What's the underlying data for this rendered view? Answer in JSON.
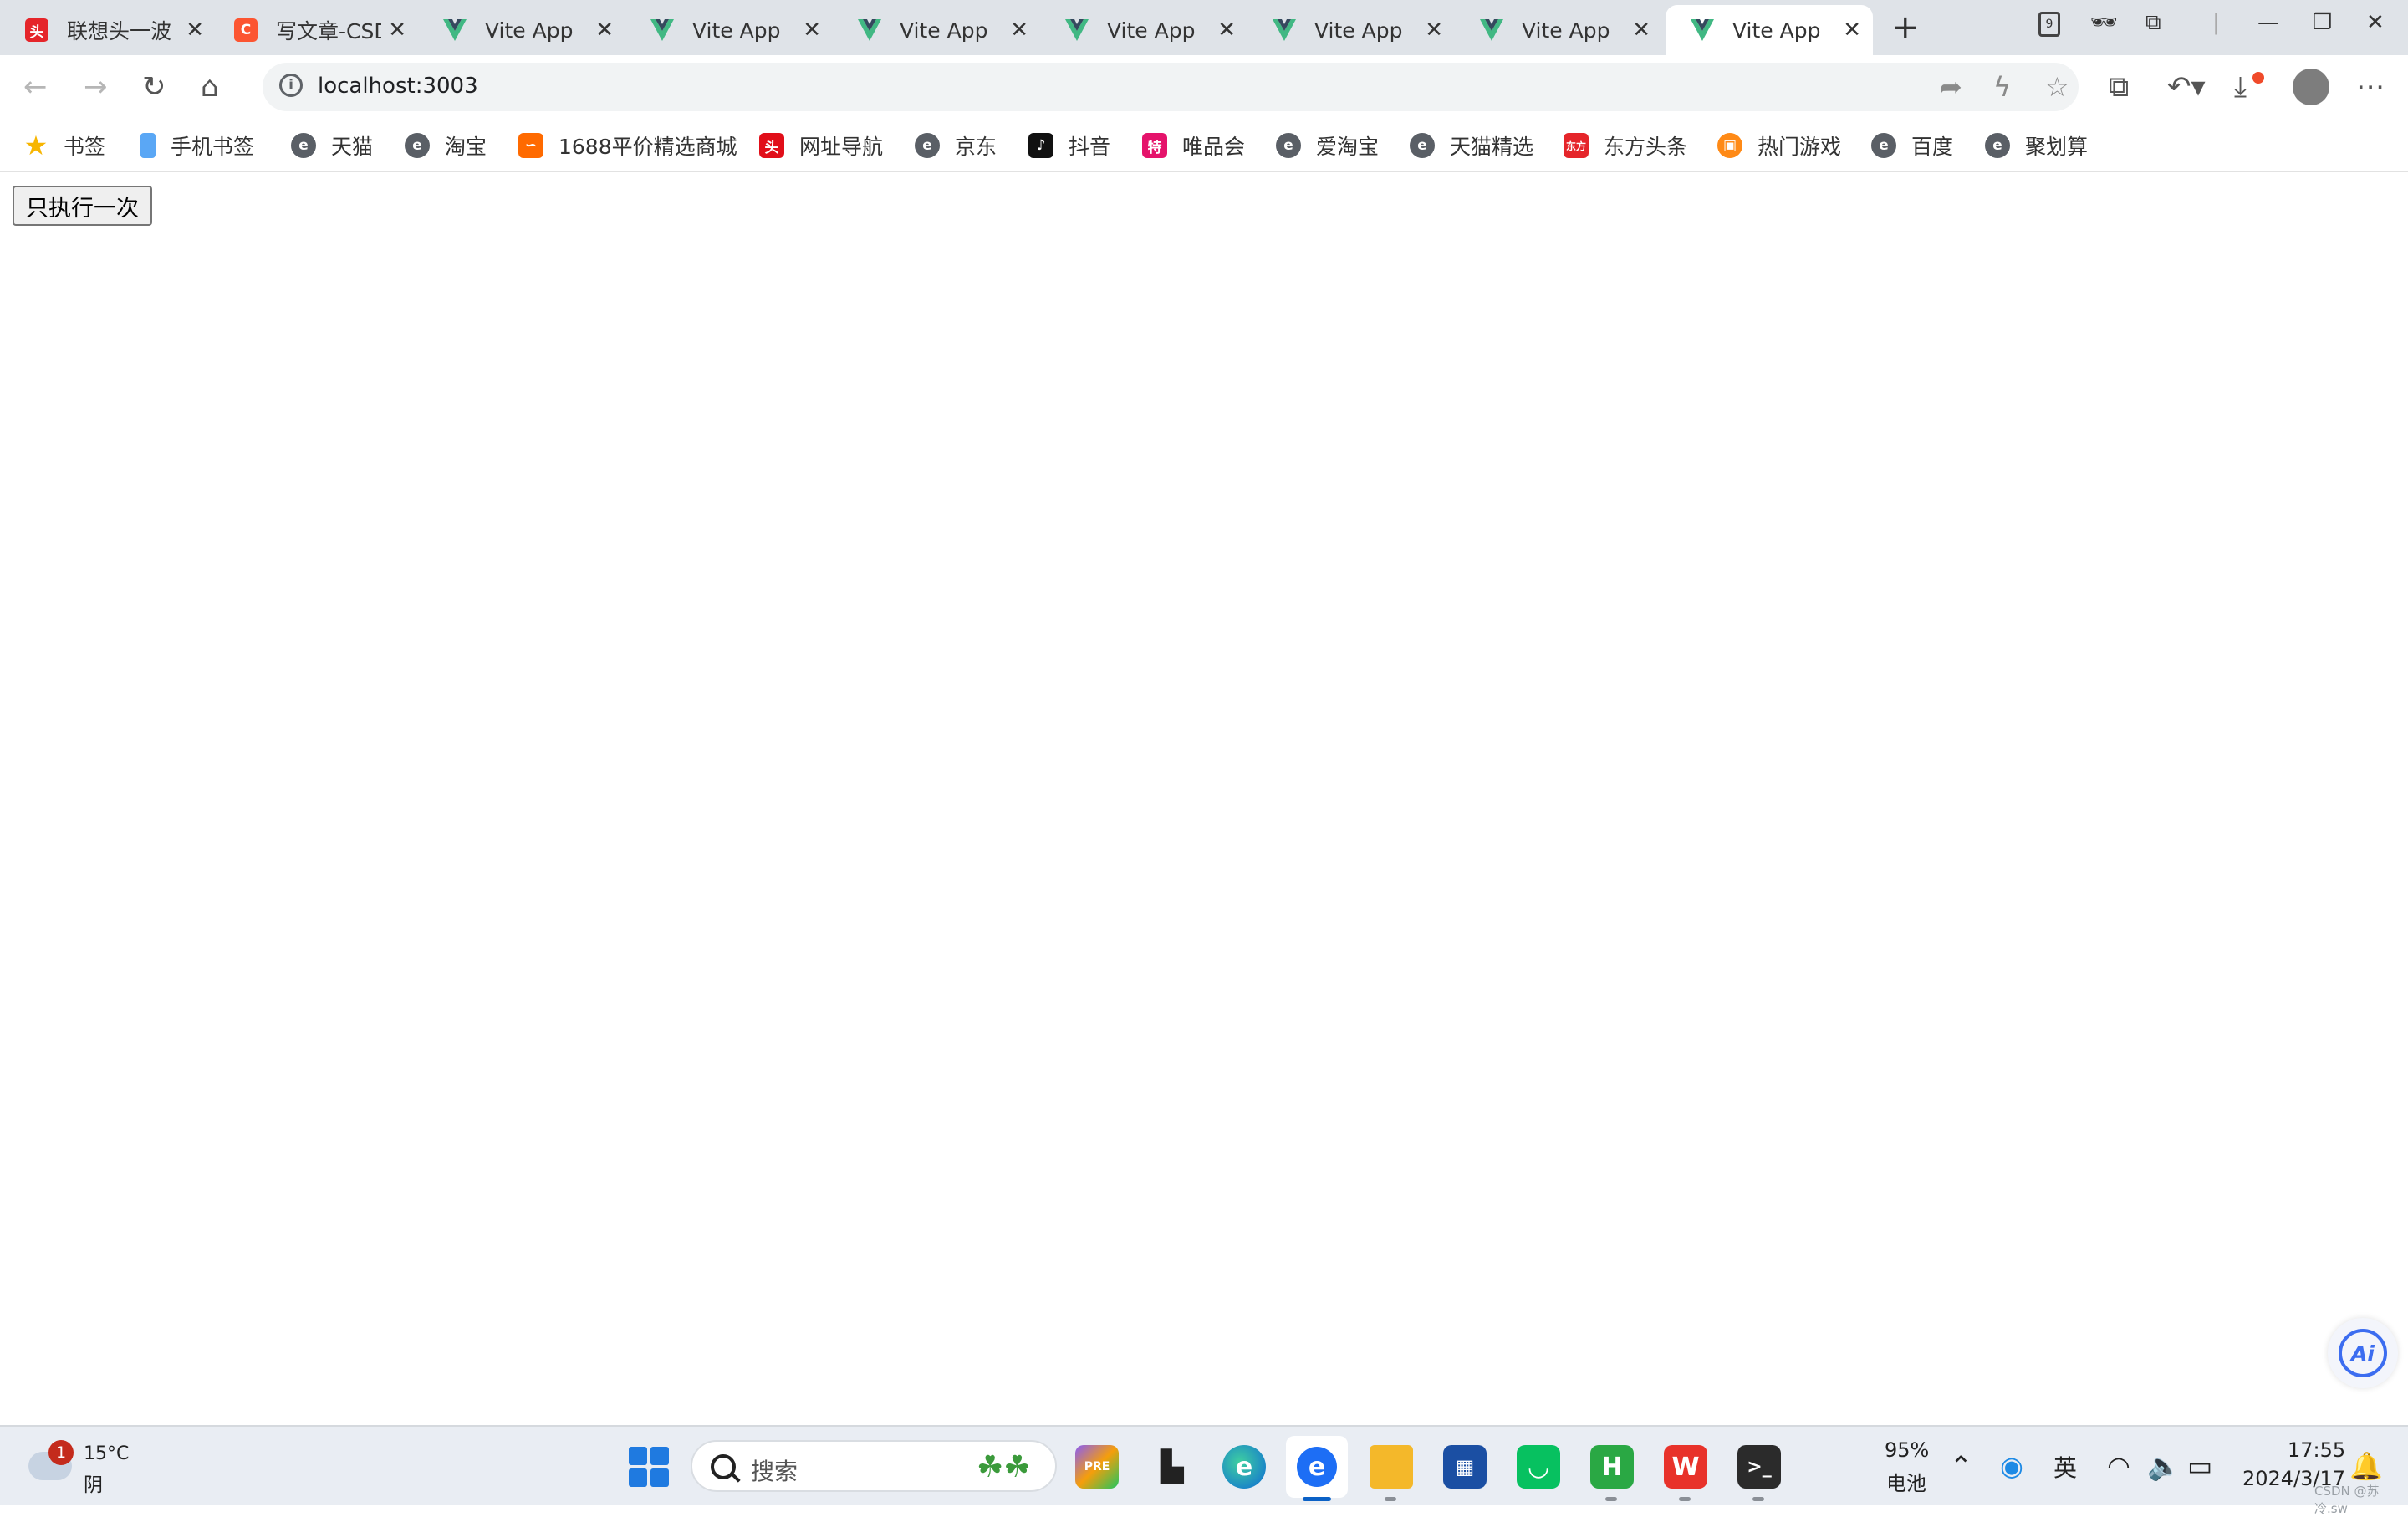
{
  "tabs": [
    {
      "title": "联想头一波",
      "favicon": "lenovo-icon"
    },
    {
      "title": "写文章-CSDN",
      "favicon": "csdn-icon"
    },
    {
      "title": "Vite App",
      "favicon": "vue-icon"
    },
    {
      "title": "Vite App",
      "favicon": "vue-icon"
    },
    {
      "title": "Vite App",
      "favicon": "vue-icon"
    },
    {
      "title": "Vite App",
      "favicon": "vue-icon"
    },
    {
      "title": "Vite App",
      "favicon": "vue-icon"
    },
    {
      "title": "Vite App",
      "favicon": "vue-icon"
    },
    {
      "title": "Vite App",
      "favicon": "vue-icon",
      "active": true
    }
  ],
  "tab_badge_count": "9",
  "address_bar": {
    "url": "localhost:3003"
  },
  "bookmarks": [
    {
      "label": "书签"
    },
    {
      "label": "手机书签"
    },
    {
      "label": "天猫"
    },
    {
      "label": "淘宝"
    },
    {
      "label": "1688平价精选商城"
    },
    {
      "label": "网址导航"
    },
    {
      "label": "京东"
    },
    {
      "label": "抖音"
    },
    {
      "label": "唯品会"
    },
    {
      "label": "爱淘宝"
    },
    {
      "label": "天猫精选"
    },
    {
      "label": "东方头条"
    },
    {
      "label": "热门游戏"
    },
    {
      "label": "百度"
    },
    {
      "label": "聚划算"
    }
  ],
  "page": {
    "button_label": "只执行一次"
  },
  "ai_button": {
    "label": "Ai"
  },
  "taskbar": {
    "weather": {
      "badge": "1",
      "temp": "15°C",
      "condition": "阴"
    },
    "search_placeholder": "搜索",
    "battery_percent": "95%",
    "battery_label": "电池",
    "ime": "英",
    "time": "17:55",
    "date": "2024/3/17"
  },
  "watermark": "CSDN @苏冷.sw",
  "colors": {
    "accent": "#0b61c6",
    "vue_green": "#41b883",
    "csdn_orange": "#fc5531"
  }
}
